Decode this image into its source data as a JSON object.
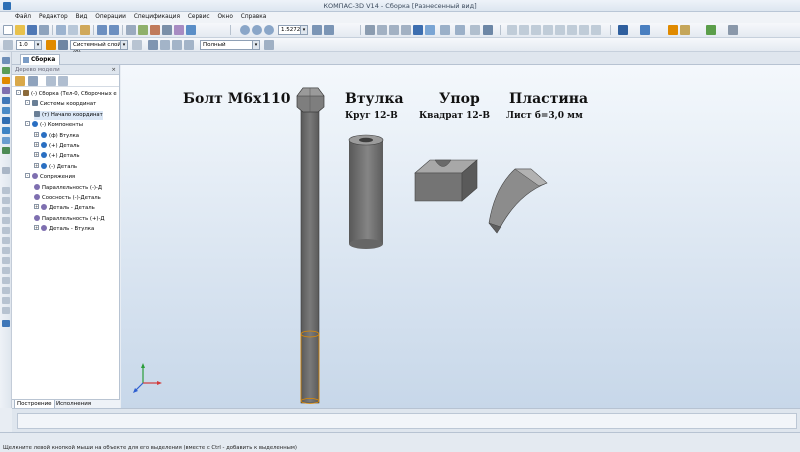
{
  "window": {
    "title": "КОМПАС-3D V14 - Сборка [Разнесенный вид]"
  },
  "menu": [
    "Файл",
    "Редактор",
    "Вид",
    "Операции",
    "Спецификация",
    "Сервис",
    "Окно",
    "Справка"
  ],
  "toolbar": {
    "zoom_value": "1.5272",
    "step_value": "1.0",
    "layer_value": "Системный слой (0)",
    "view_mode_value": "Полный"
  },
  "document_tab": {
    "label": "Сборка"
  },
  "tree": {
    "header": "Дерево модели",
    "nodes": [
      {
        "label": "(-) Сборка (Тел-0, Сборочных е",
        "level": 0,
        "toggle": "-",
        "icon": "asm"
      },
      {
        "label": "Системы координат",
        "level": 1,
        "toggle": "-",
        "icon": "coord"
      },
      {
        "label": "(т) Начало координат",
        "level": 2,
        "toggle": "",
        "icon": "coord",
        "selected": true
      },
      {
        "label": "(-) Компоненты",
        "level": 1,
        "toggle": "-",
        "icon": "comp"
      },
      {
        "label": "(ф) Втулка",
        "level": 2,
        "toggle": "+",
        "icon": "comp"
      },
      {
        "label": "(+) Деталь",
        "level": 2,
        "toggle": "+",
        "icon": "comp"
      },
      {
        "label": "(+) Деталь",
        "level": 2,
        "toggle": "+",
        "icon": "comp"
      },
      {
        "label": "(-) Деталь",
        "level": 2,
        "toggle": "+",
        "icon": "comp"
      },
      {
        "label": "Сопряжения",
        "level": 1,
        "toggle": "-",
        "icon": "mate"
      },
      {
        "label": "Параллельность (-)-Д",
        "level": 2,
        "toggle": "",
        "icon": "mate"
      },
      {
        "label": "Соосность (-)-Деталь",
        "level": 2,
        "toggle": "",
        "icon": "mate"
      },
      {
        "label": "Деталь - Деталь",
        "level": 2,
        "toggle": "+",
        "icon": "mate"
      },
      {
        "label": "Параллельность (+)-Д",
        "level": 2,
        "toggle": "",
        "icon": "mate"
      },
      {
        "label": "Деталь - Втулка",
        "level": 2,
        "toggle": "+",
        "icon": "mate"
      }
    ],
    "tabs": [
      "Построение",
      "Исполнения"
    ]
  },
  "viewport": {
    "labels": {
      "bolt": "Болт М6х110",
      "bushing": "Втулка",
      "bushing_sub": "Круг 12-В",
      "stop": "Упор",
      "stop_sub": "Квадрат 12-В",
      "plate": "Пластина",
      "plate_sub": "Лист б=3,0 мм"
    }
  },
  "status": {
    "hint": "Щелкните левой кнопкой мыши на объекте для его выделения (вместе с Ctrl - добавить к выделенным)"
  },
  "colors": {
    "part": "#6f6f6f",
    "part_light": "#9a9a9a",
    "part_dark": "#4f4f4f",
    "accent": "#e08a00"
  }
}
